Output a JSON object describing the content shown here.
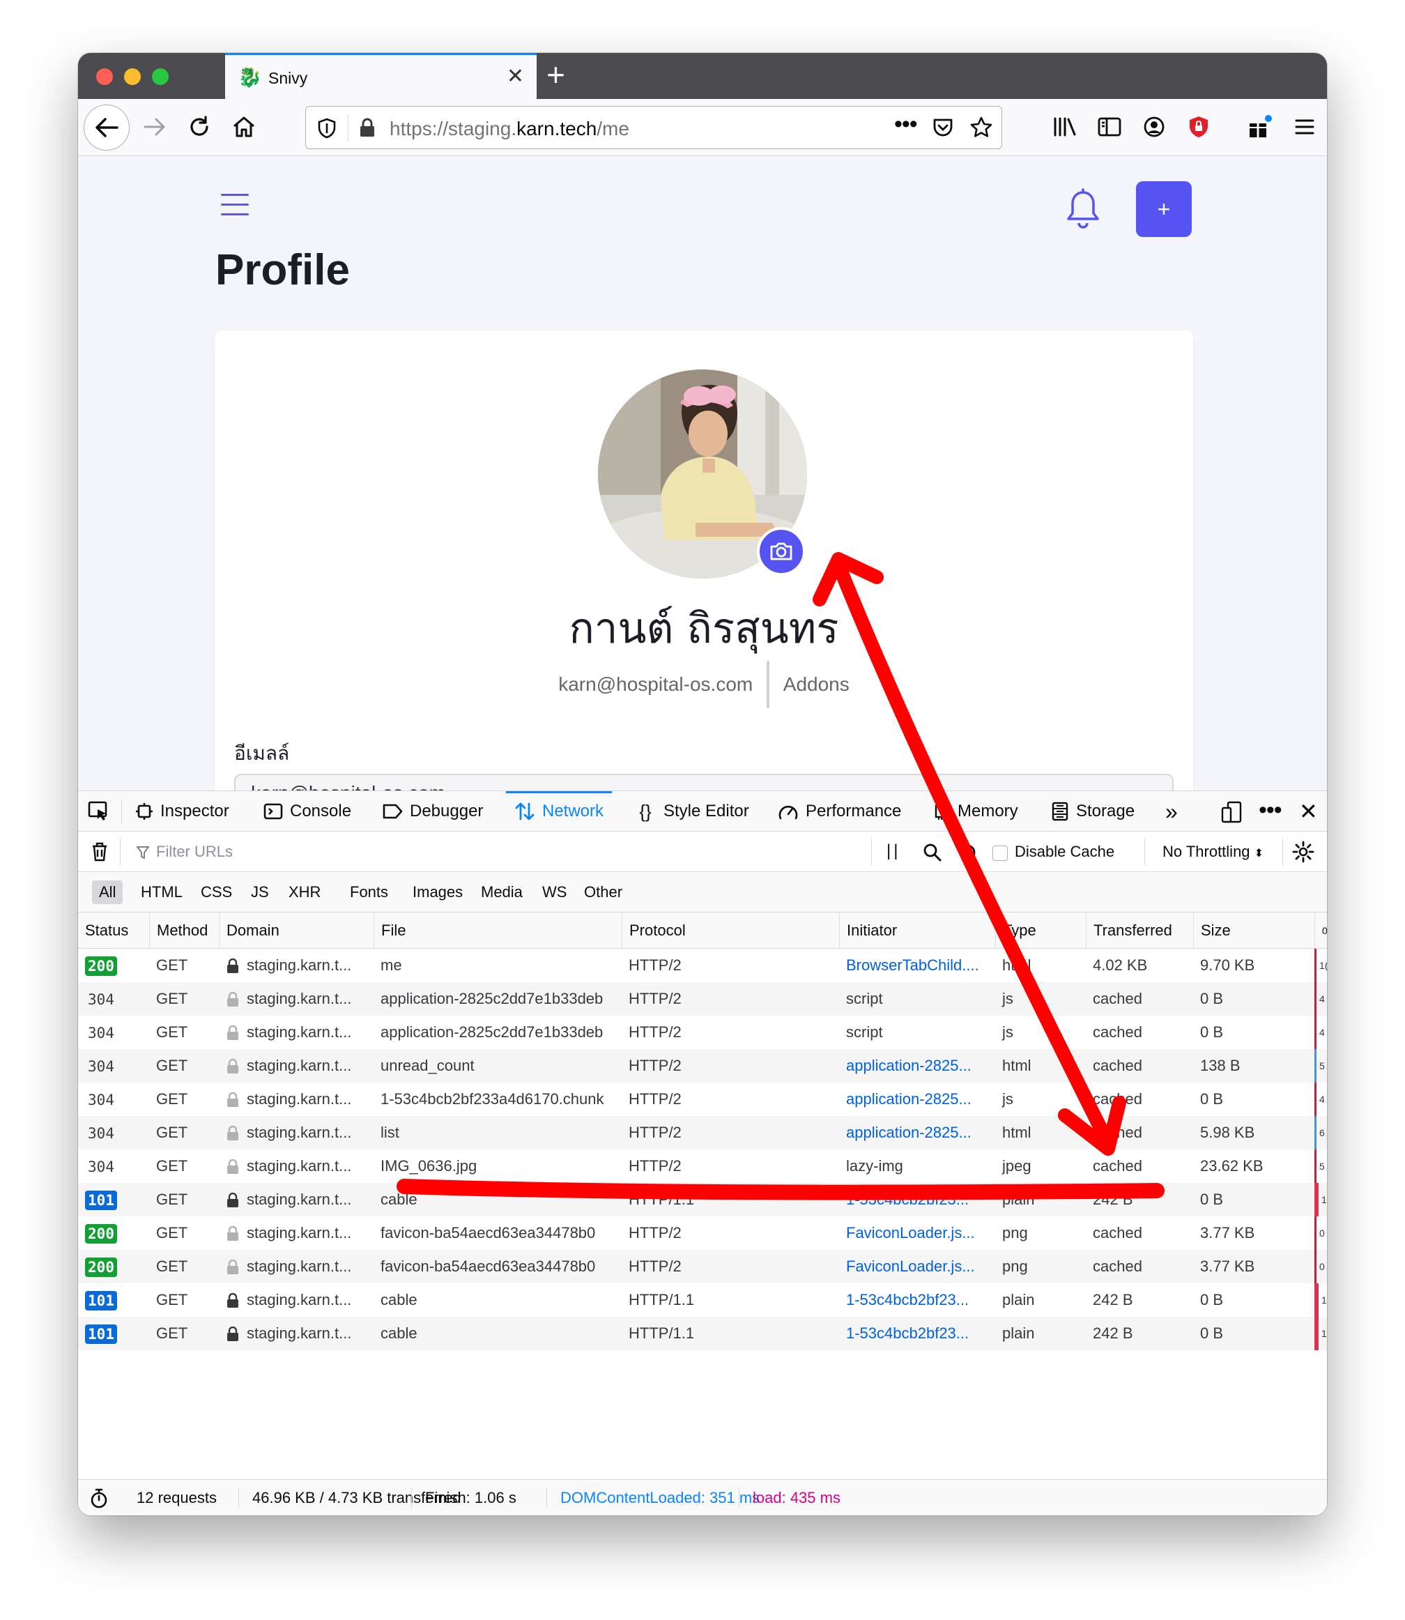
{
  "browser": {
    "tab_title": "Snivy",
    "url_prefix": "https://staging.",
    "url_domain": "karn.tech",
    "url_path": "/me"
  },
  "page": {
    "heading": "Profile",
    "plus_label": "+",
    "name": "กานต์ ถิรสุนทร",
    "email": "karn@hospital-os.com",
    "addons": "Addons",
    "email_label": "อีเมลล์",
    "email_value": "karn@hospital-os.com"
  },
  "devtools": {
    "tabs": [
      "Inspector",
      "Console",
      "Debugger",
      "Network",
      "Style Editor",
      "Performance",
      "Memory",
      "Storage"
    ],
    "filter_placeholder": "Filter URLs",
    "disable_cache": "Disable Cache",
    "throttling": "No Throttling",
    "types": [
      "All",
      "HTML",
      "CSS",
      "JS",
      "XHR",
      "Fonts",
      "Images",
      "Media",
      "WS",
      "Other"
    ],
    "columns": [
      "Status",
      "Method",
      "Domain",
      "File",
      "Protocol",
      "Initiator",
      "Type",
      "Transferred",
      "Size",
      "0"
    ],
    "rows": [
      {
        "status": "200",
        "method": "GET",
        "domain": "staging.karn.t...",
        "file": "me",
        "protocol": "HTTP/2",
        "initiator": "BrowserTabChild....",
        "type": "html",
        "transferred": "4.02 KB",
        "size": "9.70 KB",
        "wf": "1(",
        "lockdark": true,
        "initlink": true
      },
      {
        "status": "304",
        "method": "GET",
        "domain": "staging.karn.t...",
        "file": "application-2825c2dd7e1b33deb",
        "protocol": "HTTP/2",
        "initiator": "script",
        "type": "js",
        "transferred": "cached",
        "size": "0 B",
        "wf": "4",
        "lockdark": false,
        "initlink": false
      },
      {
        "status": "304",
        "method": "GET",
        "domain": "staging.karn.t...",
        "file": "application-2825c2dd7e1b33deb",
        "protocol": "HTTP/2",
        "initiator": "script",
        "type": "js",
        "transferred": "cached",
        "size": "0 B",
        "wf": "4",
        "lockdark": false,
        "initlink": false
      },
      {
        "status": "304",
        "method": "GET",
        "domain": "staging.karn.t...",
        "file": "unread_count",
        "protocol": "HTTP/2",
        "initiator": "application-2825...",
        "type": "html",
        "transferred": "cached",
        "size": "138 B",
        "wf": "5",
        "lockdark": false,
        "initlink": true
      },
      {
        "status": "304",
        "method": "GET",
        "domain": "staging.karn.t...",
        "file": "1-53c4bcb2bf233a4d6170.chunk",
        "protocol": "HTTP/2",
        "initiator": "application-2825...",
        "type": "js",
        "transferred": "cached",
        "size": "0 B",
        "wf": "4",
        "lockdark": false,
        "initlink": true
      },
      {
        "status": "304",
        "method": "GET",
        "domain": "staging.karn.t...",
        "file": "list",
        "protocol": "HTTP/2",
        "initiator": "application-2825...",
        "type": "html",
        "transferred": "cached",
        "size": "5.98 KB",
        "wf": "6",
        "lockdark": false,
        "initlink": true
      },
      {
        "status": "304",
        "method": "GET",
        "domain": "staging.karn.t...",
        "file": "IMG_0636.jpg",
        "protocol": "HTTP/2",
        "initiator": "lazy-img",
        "type": "jpeg",
        "transferred": "cached",
        "size": "23.62 KB",
        "wf": "5",
        "lockdark": false,
        "initlink": false
      },
      {
        "status": "101",
        "method": "GET",
        "domain": "staging.karn.t...",
        "file": "cable",
        "protocol": "HTTP/1.1",
        "initiator": "1-53c4bcb2bf23...",
        "type": "plain",
        "transferred": "242 B",
        "size": "0 B",
        "wf": "1",
        "lockdark": true,
        "initlink": true
      },
      {
        "status": "200",
        "method": "GET",
        "domain": "staging.karn.t...",
        "file": "favicon-ba54aecd63ea34478b0",
        "protocol": "HTTP/2",
        "initiator": "FaviconLoader.js...",
        "type": "png",
        "transferred": "cached",
        "size": "3.77 KB",
        "wf": "0",
        "lockdark": false,
        "initlink": true
      },
      {
        "status": "200",
        "method": "GET",
        "domain": "staging.karn.t...",
        "file": "favicon-ba54aecd63ea34478b0",
        "protocol": "HTTP/2",
        "initiator": "FaviconLoader.js...",
        "type": "png",
        "transferred": "cached",
        "size": "3.77 KB",
        "wf": "0",
        "lockdark": false,
        "initlink": true
      },
      {
        "status": "101",
        "method": "GET",
        "domain": "staging.karn.t...",
        "file": "cable",
        "protocol": "HTTP/1.1",
        "initiator": "1-53c4bcb2bf23...",
        "type": "plain",
        "transferred": "242 B",
        "size": "0 B",
        "wf": "1",
        "lockdark": true,
        "initlink": true
      },
      {
        "status": "101",
        "method": "GET",
        "domain": "staging.karn.t...",
        "file": "cable",
        "protocol": "HTTP/1.1",
        "initiator": "1-53c4bcb2bf23...",
        "type": "plain",
        "transferred": "242 B",
        "size": "0 B",
        "wf": "1",
        "lockdark": true,
        "initlink": true
      }
    ],
    "status_colors": {
      "200": "#12a035",
      "304": "#3a3a3f",
      "101": "#0a6ad6"
    },
    "summary": {
      "requests": "12 requests",
      "transferred": "46.96 KB / 4.73 KB transferred",
      "finish": "Finish: 1.06 s",
      "dom": "DOMContentLoaded: 351 ms",
      "load": "load: 435 ms"
    }
  },
  "colors": {
    "accent": "#5553f2",
    "annotation": "#ff0000"
  }
}
